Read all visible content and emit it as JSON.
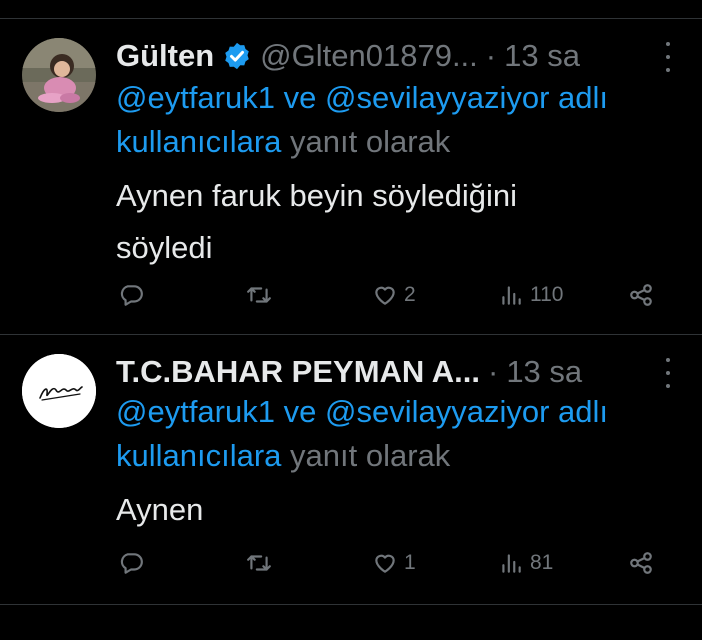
{
  "tweets": [
    {
      "name": "Gülten",
      "verified": true,
      "handle": "@Glten01879...",
      "separator": "·",
      "time": "13 sa",
      "reply_mention_1": "@eytfaruk1",
      "reply_conj": "ve",
      "reply_mention_2": "@sevilayyaziyor",
      "reply_word_adli": "adlı",
      "reply_word_users": "kullanıcılara",
      "reply_suffix": "yanıt olarak",
      "text_line1": "Aynen faruk beyin söylediğini",
      "text_line2": "söyledi",
      "replies": "",
      "retweets": "",
      "likes": "2",
      "views": "110",
      "avatar_icon": "child-photo-avatar"
    },
    {
      "name": "T.C.BAHAR PEYMAN A...",
      "verified": false,
      "separator": "·",
      "time": "13 sa",
      "reply_mention_1": "@eytfaruk1",
      "reply_conj": "ve",
      "reply_mention_2": "@sevilayyaziyor",
      "reply_word_adli": "adlı",
      "reply_word_users": "kullanıcılara",
      "reply_suffix": "yanıt olarak",
      "text_line1": "Aynen",
      "replies": "",
      "retweets": "",
      "likes": "1",
      "views": "81",
      "avatar_icon": "signature-avatar"
    }
  ],
  "colors": {
    "background": "#000000",
    "text": "#e7e9ea",
    "secondary": "#71767b",
    "link": "#1d9bf0",
    "divider": "#2f3336"
  }
}
